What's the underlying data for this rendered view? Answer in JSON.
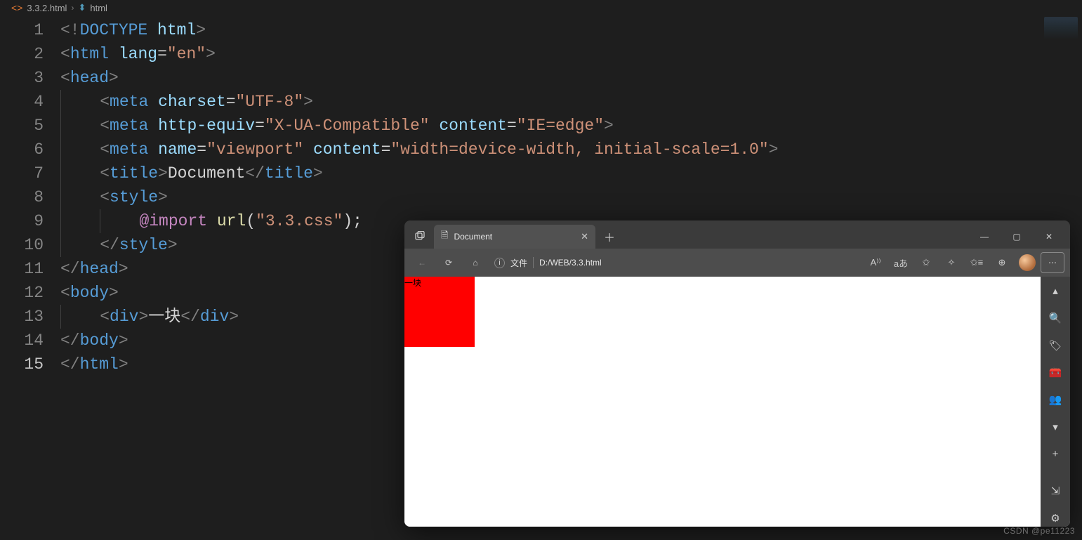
{
  "breadcrumb": {
    "file": "3.3.2.html",
    "node": "html"
  },
  "browser": {
    "tab_title": "Document",
    "proto_label": "文件",
    "address_path": "D:/WEB/3.3.html",
    "page_block_text": "一块",
    "read_aloud_label": "A⁾⁾",
    "translate_btn": "aあ"
  },
  "code_tokens": [
    [
      [
        "br",
        "<!"
      ],
      [
        "doct",
        "DOCTYPE"
      ],
      [
        "txt",
        " "
      ],
      [
        "attr",
        "html"
      ],
      [
        "br",
        ">"
      ]
    ],
    [
      [
        "br",
        "<"
      ],
      [
        "tag",
        "html"
      ],
      [
        "txt",
        " "
      ],
      [
        "attr",
        "lang"
      ],
      [
        "txt",
        "="
      ],
      [
        "str",
        "\"en\""
      ],
      [
        "br",
        ">"
      ]
    ],
    [
      [
        "br",
        "<"
      ],
      [
        "tag",
        "head"
      ],
      [
        "br",
        ">"
      ]
    ],
    [
      [
        "indent",
        1
      ],
      [
        "br",
        "<"
      ],
      [
        "tag",
        "meta"
      ],
      [
        "txt",
        " "
      ],
      [
        "attr",
        "charset"
      ],
      [
        "txt",
        "="
      ],
      [
        "str",
        "\"UTF-8\""
      ],
      [
        "br",
        ">"
      ]
    ],
    [
      [
        "indent",
        1
      ],
      [
        "br",
        "<"
      ],
      [
        "tag",
        "meta"
      ],
      [
        "txt",
        " "
      ],
      [
        "attr",
        "http-equiv"
      ],
      [
        "txt",
        "="
      ],
      [
        "str",
        "\"X-UA-Compatible\""
      ],
      [
        "txt",
        " "
      ],
      [
        "attr",
        "content"
      ],
      [
        "txt",
        "="
      ],
      [
        "str",
        "\"IE=edge\""
      ],
      [
        "br",
        ">"
      ]
    ],
    [
      [
        "indent",
        1
      ],
      [
        "br",
        "<"
      ],
      [
        "tag",
        "meta"
      ],
      [
        "txt",
        " "
      ],
      [
        "attr",
        "name"
      ],
      [
        "txt",
        "="
      ],
      [
        "str",
        "\"viewport\""
      ],
      [
        "txt",
        " "
      ],
      [
        "attr",
        "content"
      ],
      [
        "txt",
        "="
      ],
      [
        "str",
        "\"width=device-width, initial-scale=1.0\""
      ],
      [
        "br",
        ">"
      ]
    ],
    [
      [
        "indent",
        1
      ],
      [
        "br",
        "<"
      ],
      [
        "tag",
        "title"
      ],
      [
        "br",
        ">"
      ],
      [
        "txt",
        "Document"
      ],
      [
        "br",
        "</"
      ],
      [
        "tag",
        "title"
      ],
      [
        "br",
        ">"
      ]
    ],
    [
      [
        "indent",
        1
      ],
      [
        "br",
        "<"
      ],
      [
        "tag",
        "style"
      ],
      [
        "br",
        ">"
      ]
    ],
    [
      [
        "indent",
        2
      ],
      [
        "imp",
        "@import"
      ],
      [
        "txt",
        " "
      ],
      [
        "fn",
        "url"
      ],
      [
        "txt",
        "("
      ],
      [
        "str",
        "\"3.3.css\""
      ],
      [
        "txt",
        ");"
      ]
    ],
    [
      [
        "indent",
        1
      ],
      [
        "br",
        "</"
      ],
      [
        "tag",
        "style"
      ],
      [
        "br",
        ">"
      ]
    ],
    [
      [
        "br",
        "</"
      ],
      [
        "tag",
        "head"
      ],
      [
        "br",
        ">"
      ]
    ],
    [
      [
        "br",
        "<"
      ],
      [
        "tag",
        "body"
      ],
      [
        "br",
        ">"
      ]
    ],
    [
      [
        "indent",
        1
      ],
      [
        "br",
        "<"
      ],
      [
        "tag",
        "div"
      ],
      [
        "br",
        ">"
      ],
      [
        "txt",
        "一块"
      ],
      [
        "br",
        "</"
      ],
      [
        "tag",
        "div"
      ],
      [
        "br",
        ">"
      ]
    ],
    [
      [
        "br",
        "</"
      ],
      [
        "tag",
        "body"
      ],
      [
        "br",
        ">"
      ]
    ],
    [
      [
        "br",
        "</"
      ],
      [
        "tag",
        "html"
      ],
      [
        "br",
        ">"
      ]
    ]
  ],
  "line_count": 15,
  "active_line": 15,
  "watermark": "CSDN @pe11223"
}
